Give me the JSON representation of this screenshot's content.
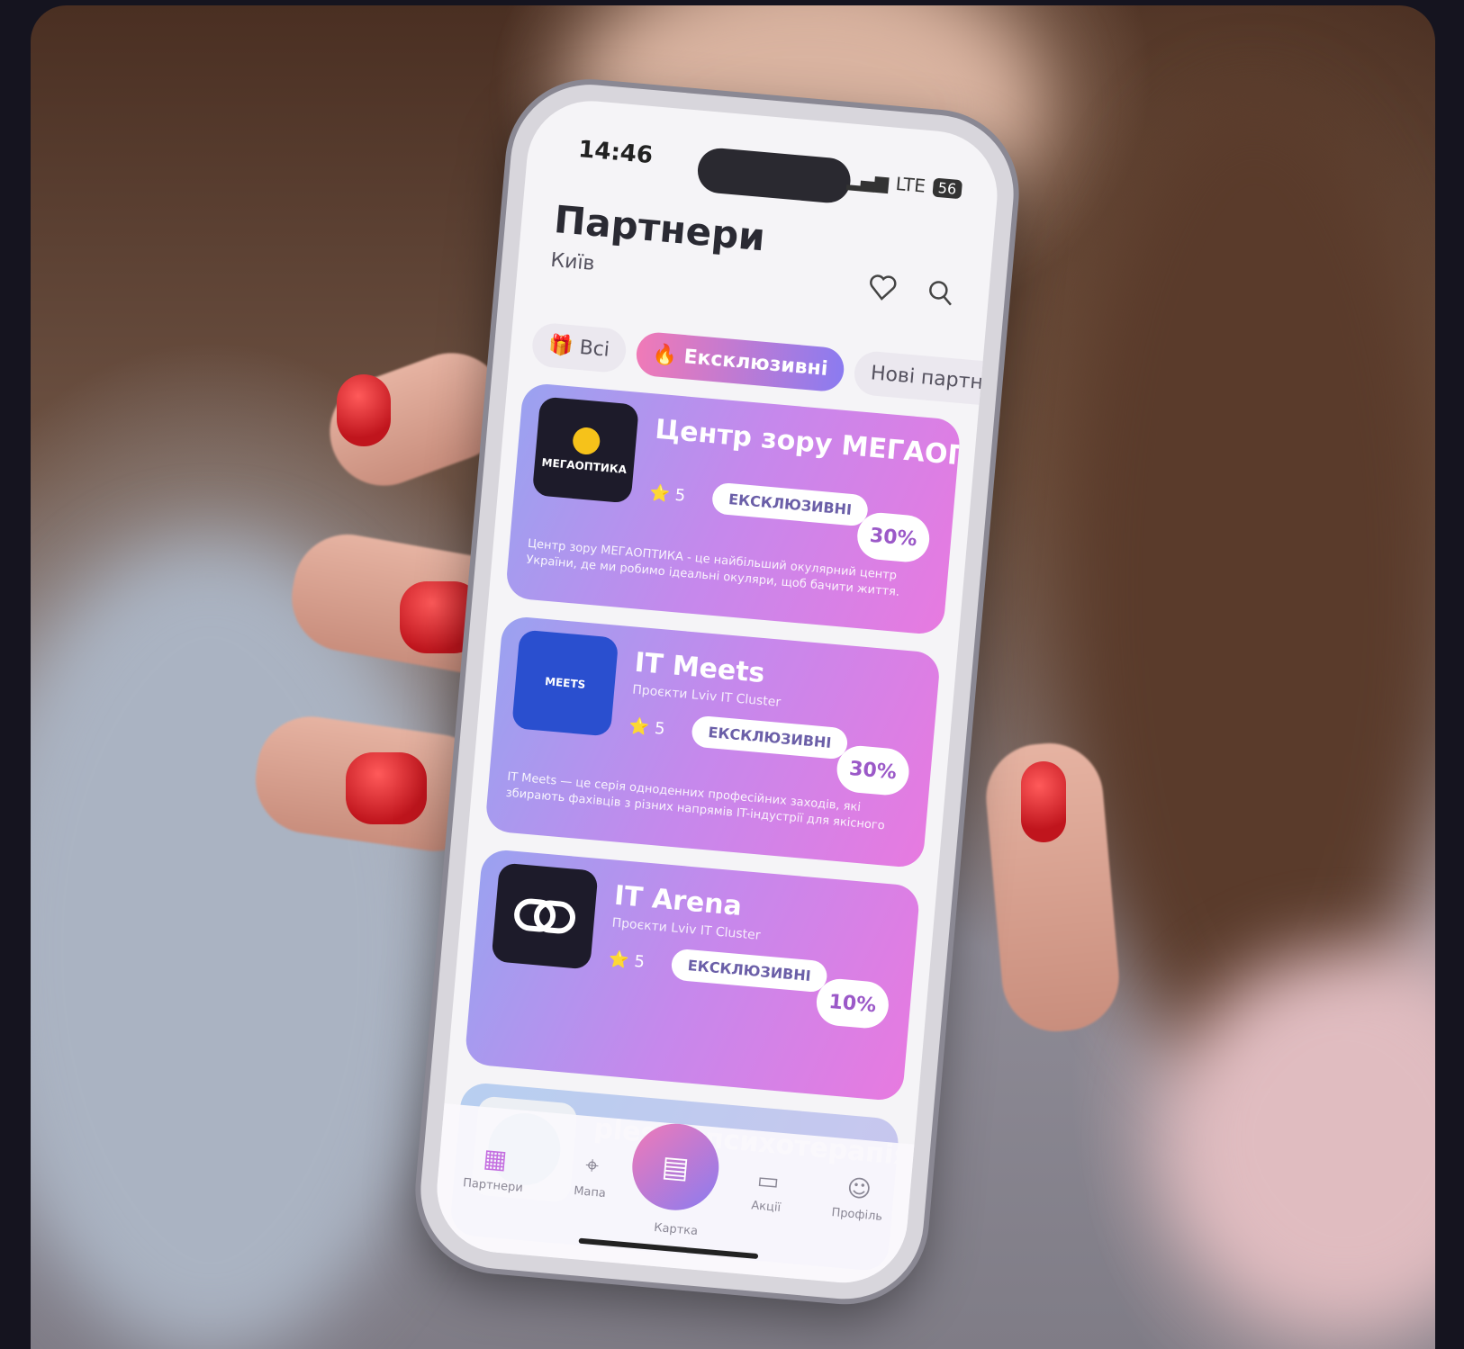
{
  "status": {
    "time": "14:46",
    "network": "LTE",
    "battery": "56"
  },
  "header": {
    "title": "Партнери",
    "city": "Київ"
  },
  "tabs": [
    {
      "label": "Всі",
      "icon": "gift-icon"
    },
    {
      "label": "Ексклюзивні",
      "icon": "fire-icon"
    },
    {
      "label": "Нові партнери"
    }
  ],
  "cards": [
    {
      "name": "Центр зору МЕГАОПТИ...",
      "subtitle": "",
      "logo_text": "МЕГАОПТИКА",
      "rating": "5",
      "badge": "ЕКСКЛЮЗИВНІ",
      "discount": "30%",
      "description": "Центр зору МЕГАОПТИКА - це найбільший окулярний центр України, де ми робимо ідеальні окуляри, щоб бачити життя."
    },
    {
      "name": "IT Meets",
      "subtitle": "Проєкти Lviv IT Cluster",
      "logo_text": "MEETS",
      "rating": "5",
      "badge": "ЕКСКЛЮЗИВНІ",
      "discount": "30%",
      "description": "IT Meets — це серія одноденних професійних заходів, які збирають фахівців з різних напрямів IT-індустрії для якісного"
    },
    {
      "name": "IT Arena",
      "subtitle": "Проєкти Lviv IT Cluster",
      "logo_text": "",
      "rating": "5",
      "badge": "ЕКСКЛЮЗИВНІ",
      "discount": "10%",
      "description": ""
    },
    {
      "name": "pleso - психотерапія о...",
      "subtitle": "",
      "logo_text": "",
      "rating": "",
      "badge": "",
      "discount": "",
      "description": ""
    }
  ],
  "nav": [
    {
      "label": "Партнери",
      "icon": "grid-icon"
    },
    {
      "label": "Мапа",
      "icon": "map-pin-icon"
    },
    {
      "label": "Картка",
      "icon": "card-icon"
    },
    {
      "label": "Акції",
      "icon": "ticket-icon"
    },
    {
      "label": "Профіль",
      "icon": "user-icon"
    }
  ]
}
